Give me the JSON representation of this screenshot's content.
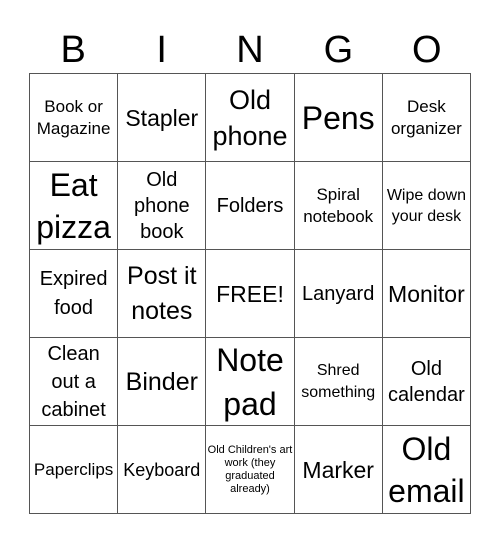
{
  "header": {
    "letters": [
      "B",
      "I",
      "N",
      "G",
      "O"
    ]
  },
  "grid": {
    "rows": [
      [
        "Book or Magazine",
        "Stapler",
        "Old phone",
        "Pens",
        "Desk organizer"
      ],
      [
        "Eat pizza",
        "Old phone book",
        "Folders",
        "Spiral notebook",
        "Wipe down your desk"
      ],
      [
        "Expired food",
        "Post it notes",
        "FREE!",
        "Lanyard",
        "Monitor"
      ],
      [
        "Clean out a cabinet",
        "Binder",
        "Note pad",
        "Shred something",
        "Old calendar"
      ],
      [
        "Paperclips",
        "Keyboard",
        "Old Children's art work (they graduated already)",
        "Marker",
        "Old email"
      ]
    ]
  }
}
